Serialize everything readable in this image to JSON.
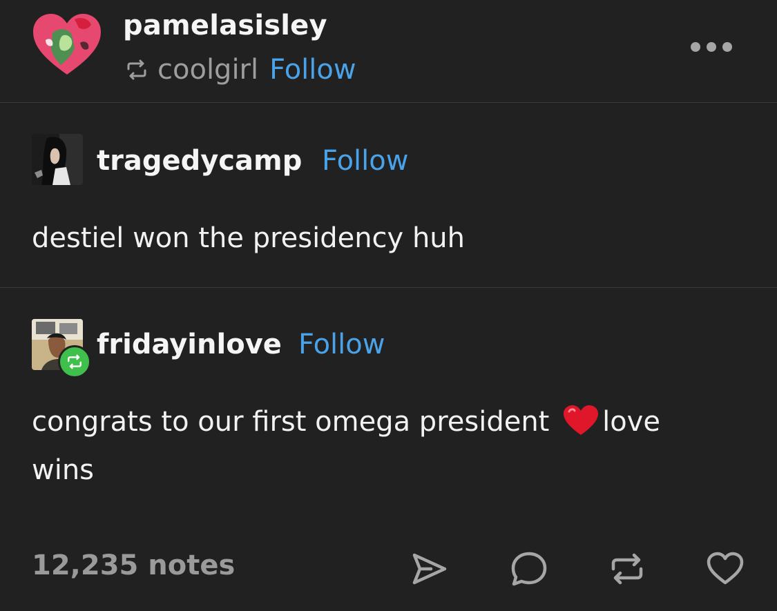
{
  "post": {
    "author": "pamelasisley",
    "reblogged_from": "coolgirl",
    "follow_label": "Follow",
    "icons": {
      "avatar": "heart-avatar",
      "reblog": "reblog-icon",
      "more": "more-options-icon"
    }
  },
  "trail": [
    {
      "username": "tragedycamp",
      "follow_label": "Follow",
      "text": "destiel won the presidency huh"
    },
    {
      "username": "fridayinlove",
      "follow_label": "Follow",
      "text_before": "congrats to our first omega president ",
      "emoji": "heart-emoji",
      "text_after": "love wins"
    }
  ],
  "footer": {
    "notes": "12,235 notes",
    "actions": [
      "share-icon",
      "reply-icon",
      "reblog-icon",
      "like-icon"
    ]
  },
  "colors": {
    "background": "#212121",
    "text": "#f2f2f2",
    "muted": "#9e9e9e",
    "link": "#4aa3e8",
    "reblog_badge": "#3fbf4b",
    "divider": "#3b3b3b"
  }
}
